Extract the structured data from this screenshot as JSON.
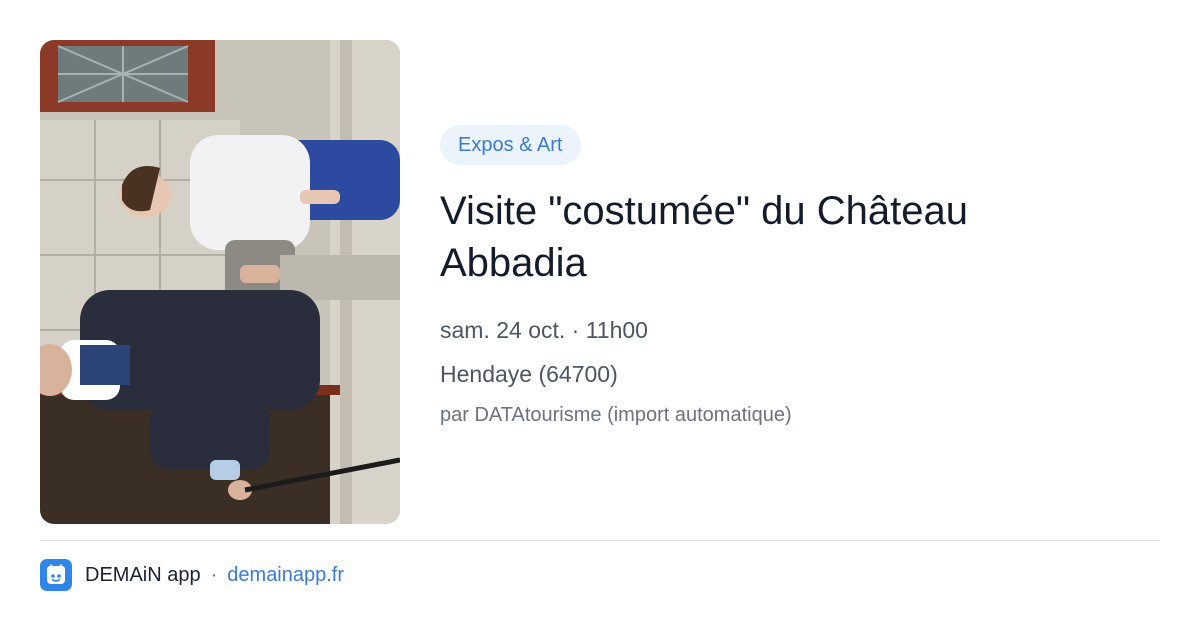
{
  "event": {
    "category": "Expos & Art",
    "title": "Visite \"costumée\" du Château Abbadia",
    "datetime": "sam. 24 oct. · 11h00",
    "location": "Hendaye (64700)",
    "source": "par DATAtourisme (import automatique)"
  },
  "footer": {
    "app_name": "DEMAiN app",
    "separator": "·",
    "site_link": "demainapp.fr"
  },
  "colors": {
    "accent": "#3a7bd5",
    "badge_bg": "#ebf3fc",
    "logo_bg": "#2f86e8"
  },
  "icons": {
    "app_logo": "demain-app-logo-icon"
  }
}
